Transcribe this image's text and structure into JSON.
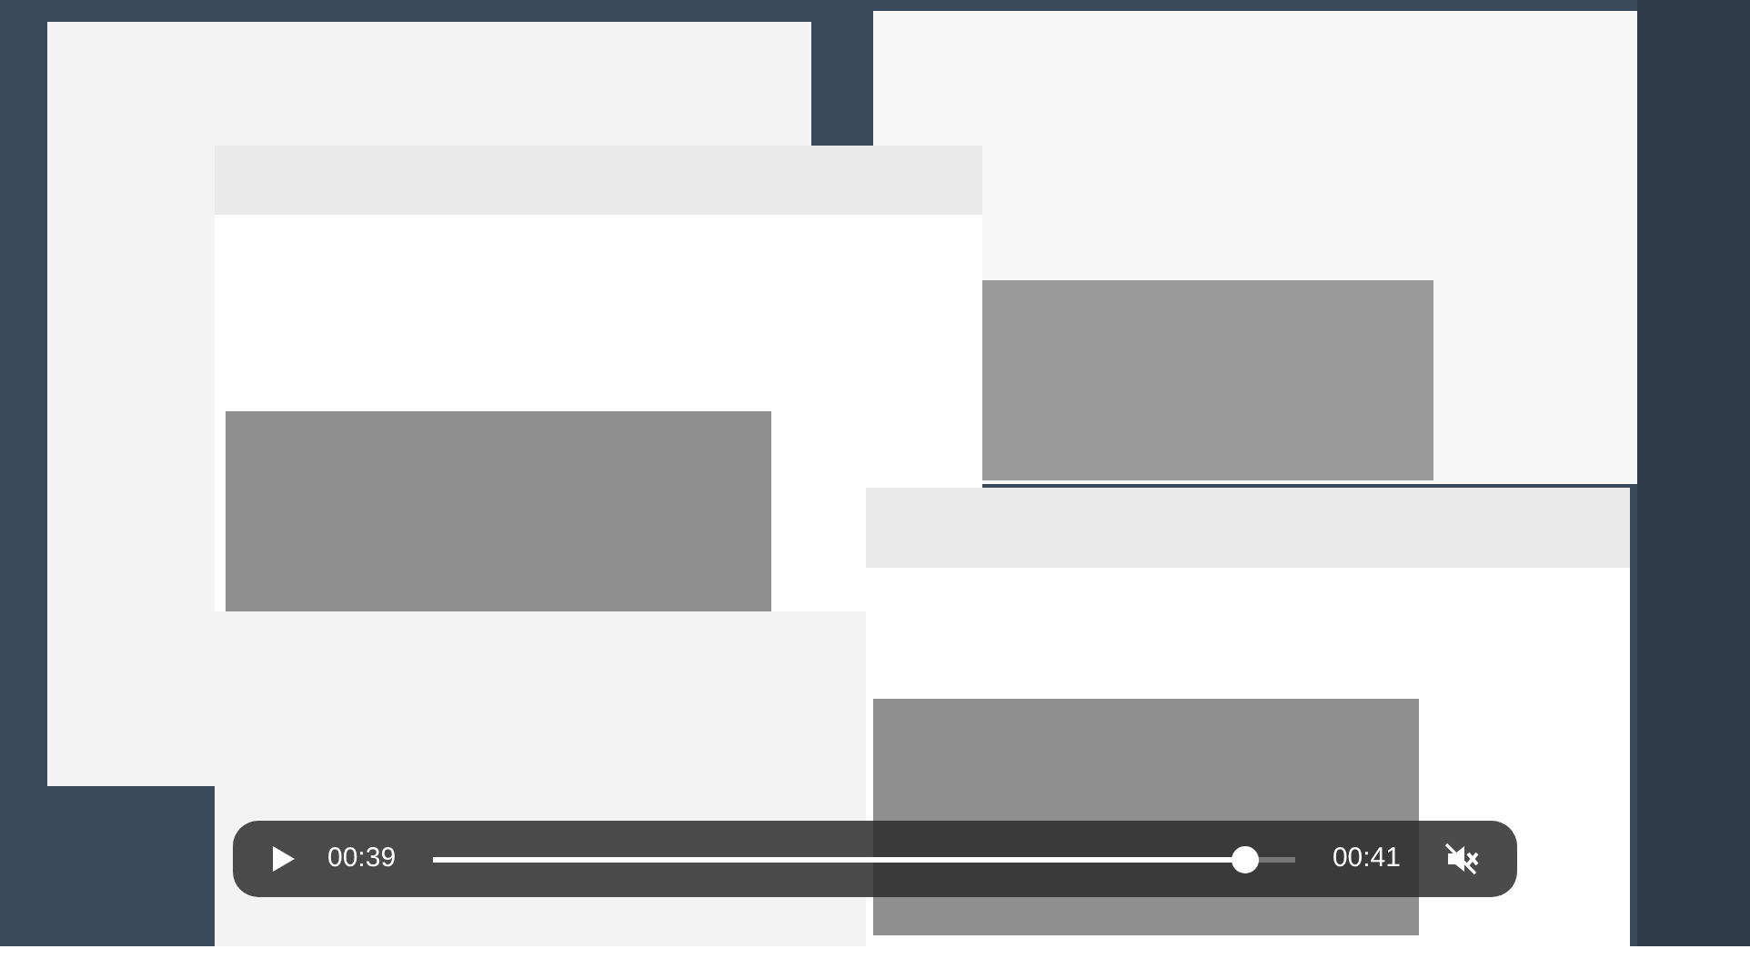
{
  "player": {
    "playing": false,
    "current_time": "00:39",
    "duration": "00:41",
    "level": 0.94,
    "muted": true
  }
}
